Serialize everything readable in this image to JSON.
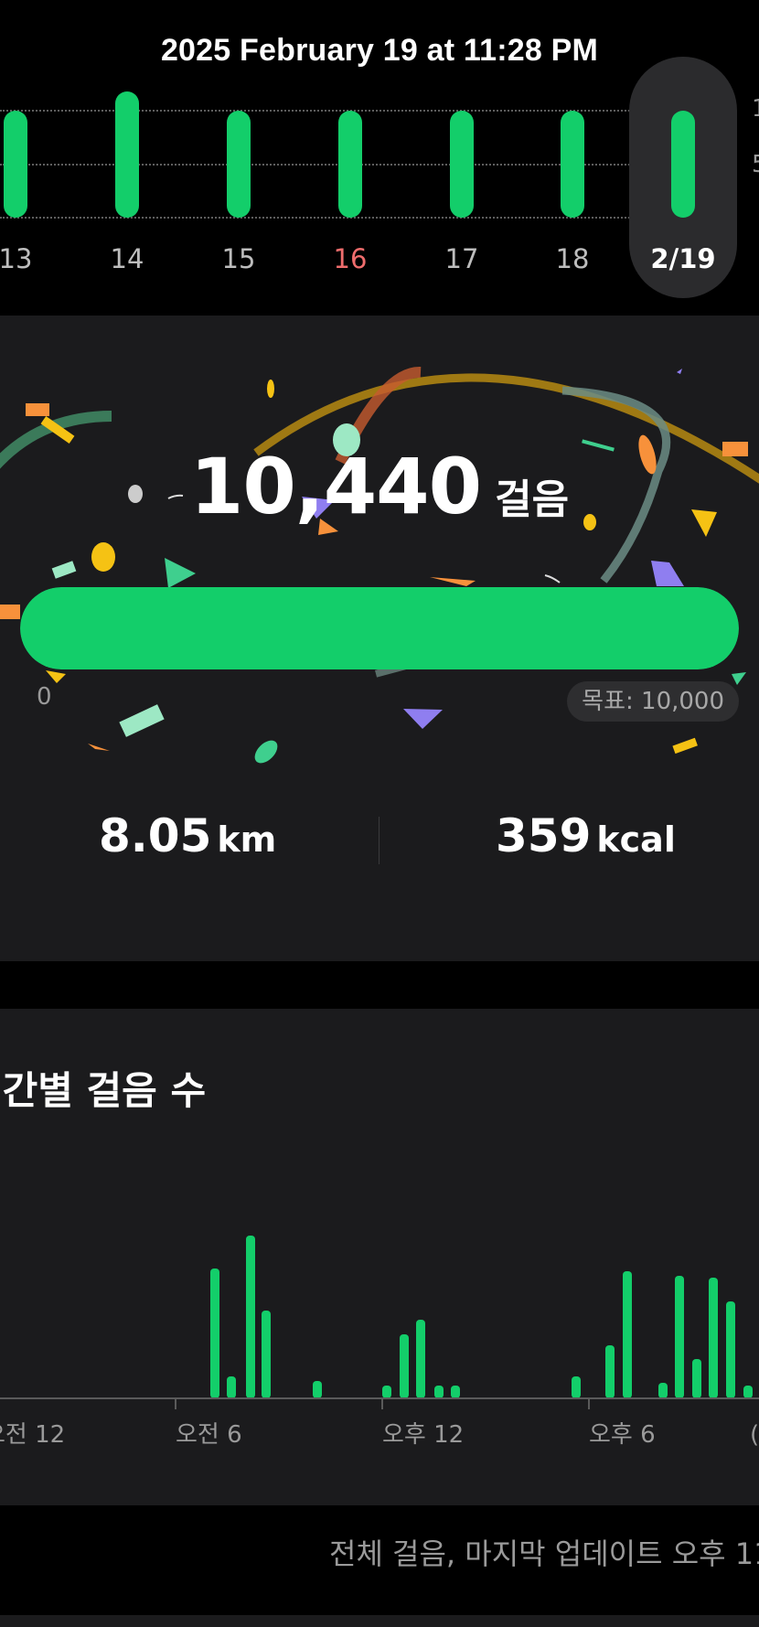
{
  "header": {
    "title": "2025 February 19 at 11:28 PM"
  },
  "week_axis": {
    "right_labels": [
      "1",
      "5"
    ]
  },
  "week": {
    "days": [
      {
        "label": "13",
        "steps_fraction_of_max": 0.85,
        "weekend": false,
        "selected": false
      },
      {
        "label": "14",
        "steps_fraction_of_max": 1.0,
        "weekend": false,
        "selected": false
      },
      {
        "label": "15",
        "steps_fraction_of_max": 0.85,
        "weekend": false,
        "selected": false
      },
      {
        "label": "16",
        "steps_fraction_of_max": 0.85,
        "weekend": true,
        "selected": false
      },
      {
        "label": "17",
        "steps_fraction_of_max": 0.85,
        "weekend": false,
        "selected": false
      },
      {
        "label": "18",
        "steps_fraction_of_max": 0.85,
        "weekend": false,
        "selected": false
      },
      {
        "label": "2/19",
        "steps_fraction_of_max": 0.85,
        "weekend": false,
        "selected": true
      }
    ]
  },
  "summary": {
    "steps": "10,440",
    "steps_unit": "걸음",
    "progress_fraction": 1.0,
    "progress_min": "0",
    "goal_label": "목표: 10,000",
    "distance_value": "8.05",
    "distance_unit": "km",
    "calories_value": "359",
    "calories_unit": "kcal"
  },
  "colors": {
    "accent": "#13ce6a",
    "weekend": "#ee6c6c",
    "card": "#1b1b1d",
    "confetti": [
      "#f7913b",
      "#f5c214",
      "#8f7ef0",
      "#9de8c4",
      "#3fcf8e",
      "#c75b2f",
      "#7a8c88"
    ]
  },
  "hourly": {
    "title": "시간별 걸음 수",
    "axis_labels": [
      "오전 12",
      "오전 6",
      "오후 12",
      "오후 6",
      "("
    ],
    "chart_data": {
      "type": "bar",
      "categories": [
        "0",
        "1",
        "2",
        "3",
        "4",
        "5",
        "6",
        "7",
        "8",
        "9",
        "10",
        "11",
        "12",
        "13",
        "14",
        "15",
        "16",
        "17",
        "18",
        "19",
        "20",
        "21",
        "22",
        "23"
      ],
      "series": [
        {
          "values": [
            0,
            0,
            0,
            0,
            0,
            0,
            0,
            0,
            0,
            0,
            0,
            0,
            0,
            0,
            0,
            0,
            0,
            0,
            0,
            0,
            0,
            0,
            0,
            0
          ]
        }
      ],
      "bars_fraction_of_max": [
        0.59,
        0.1,
        0.74,
        0.4,
        0.08,
        0.05,
        0.29,
        0.36,
        0.05,
        0.05,
        0.1,
        0.24,
        0.58,
        0.07,
        0.56,
        0.18,
        0.55,
        0.44,
        0.05,
        1.0
      ]
    }
  },
  "footer": {
    "text": "전체 걸음, 마지막 업데이트 오후 11:2"
  }
}
